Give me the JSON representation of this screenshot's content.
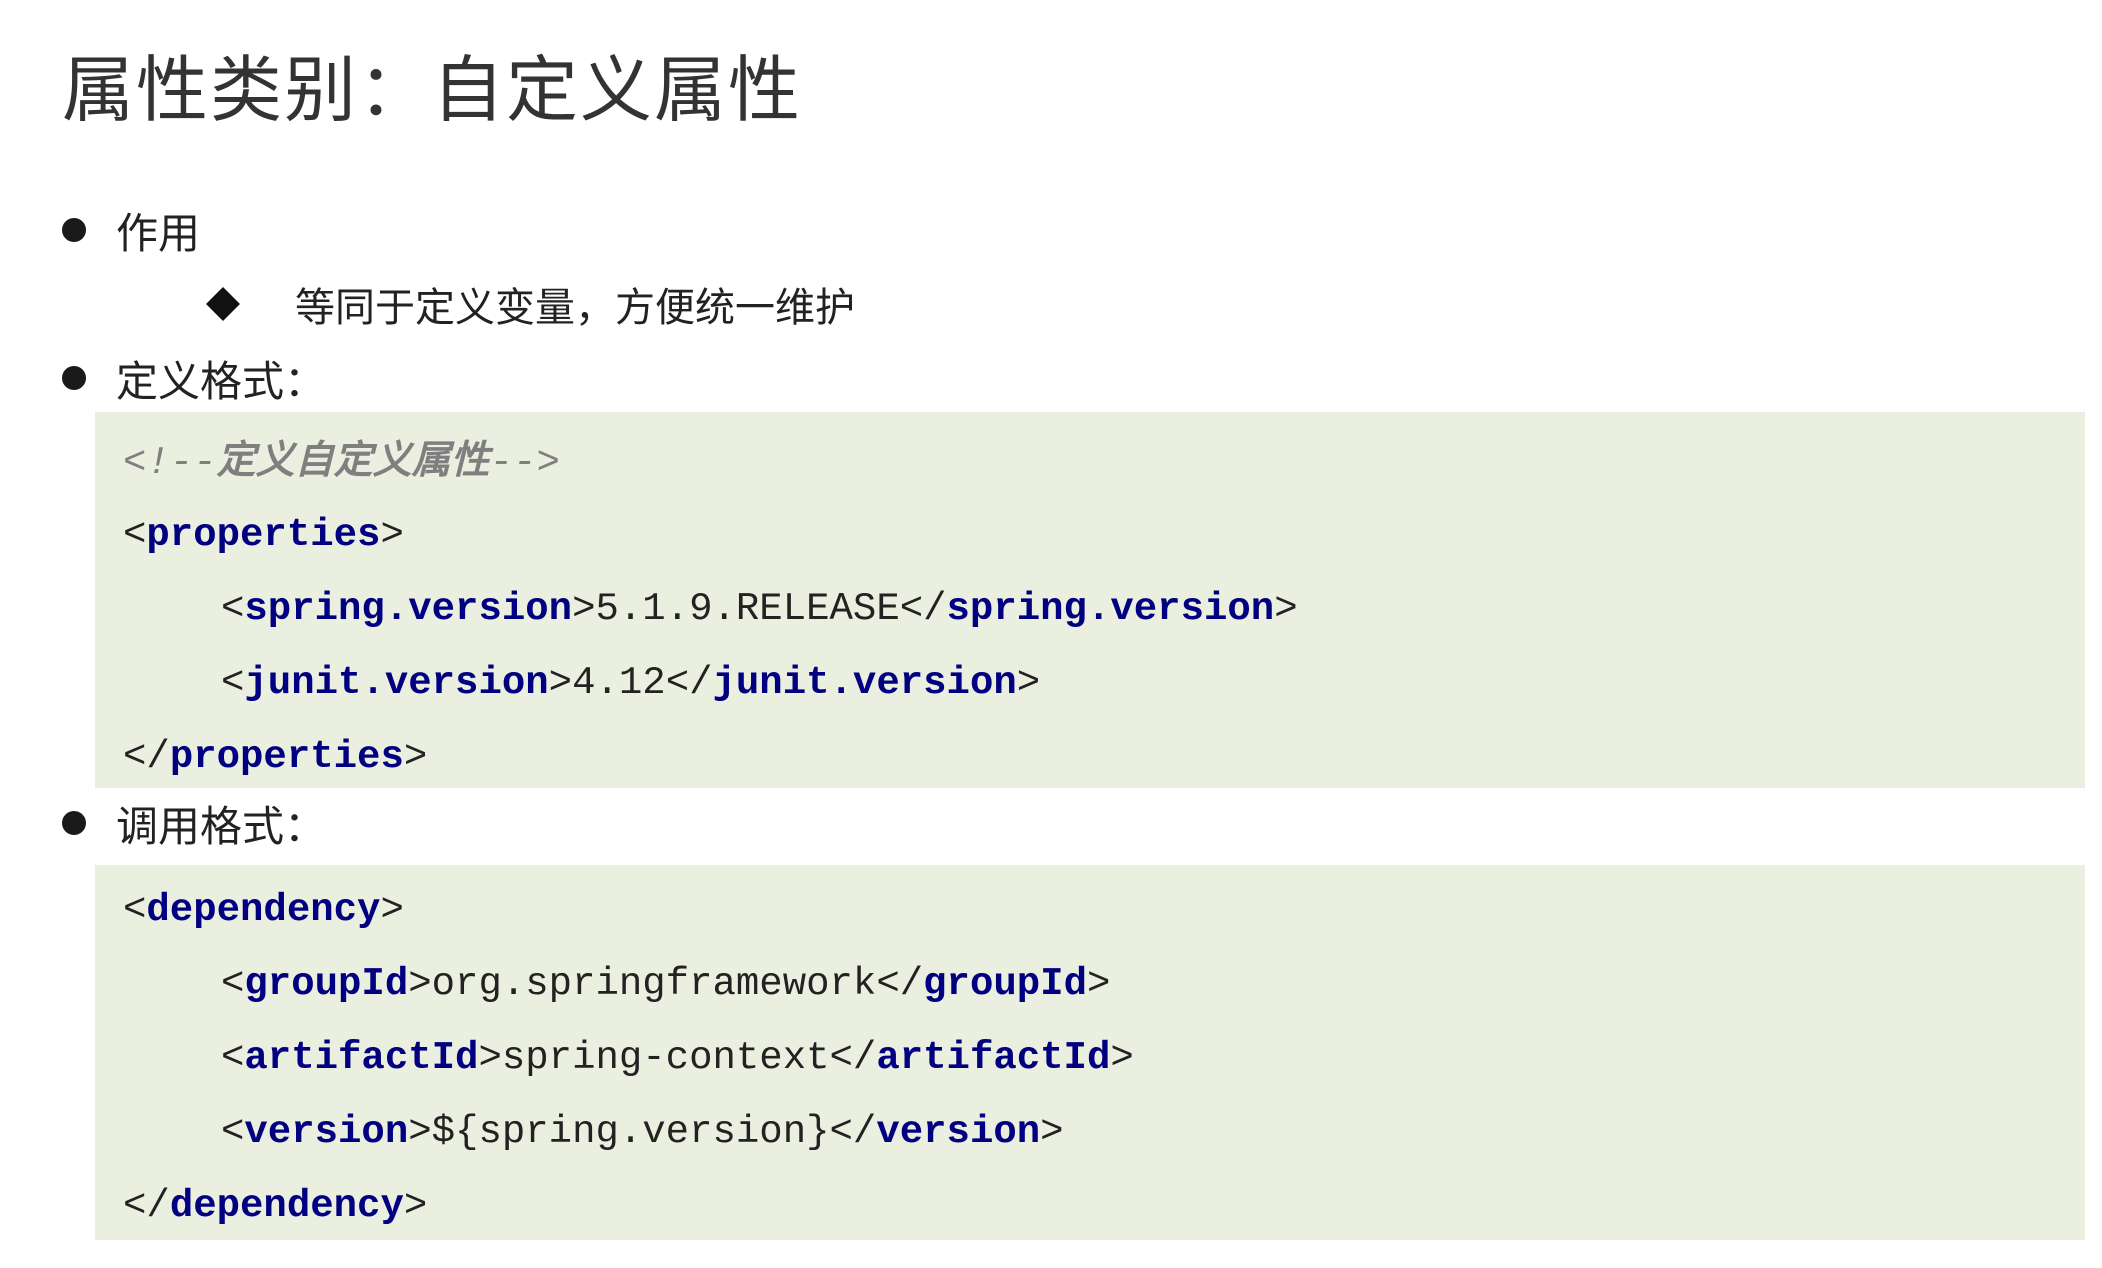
{
  "title": "属性类别：自定义属性",
  "bullets": {
    "usage": {
      "label": "作用",
      "sub": "等同于定义变量，方便统一维护"
    },
    "define": {
      "label": "定义格式："
    },
    "invoke": {
      "label": "调用格式："
    }
  },
  "define_code": {
    "comment_open": "<!--",
    "comment_text": "定义自定义属性",
    "comment_close": "-->",
    "properties_tag": "properties",
    "spring_tag": "spring.version",
    "spring_value": "5.1.9.RELEASE",
    "junit_tag": "junit.version",
    "junit_value": "4.12"
  },
  "invoke_code": {
    "dependency_tag": "dependency",
    "group_tag": "groupId",
    "group_value": "org.springframework",
    "artifact_tag": "artifactId",
    "artifact_value": "spring-context",
    "version_tag": "version",
    "version_value": "${spring.version}"
  },
  "colors": {
    "code_background": "#ebefdf",
    "tag": "#000080",
    "comment": "#7f7f7f"
  }
}
